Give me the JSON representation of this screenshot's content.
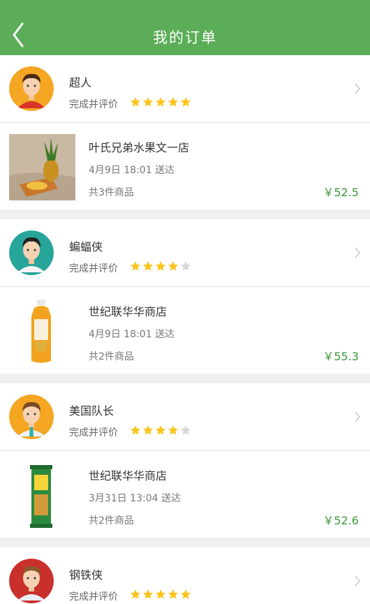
{
  "header": {
    "title": "我的订单"
  },
  "colors": {
    "accent": "#5cad58",
    "price": "#3a9a3a",
    "star_on": "#f9c51c",
    "star_off": "#d8d8d8"
  },
  "orders": [
    {
      "user": {
        "name": "超人",
        "status": "完成并评价",
        "rating": 5,
        "avatar_icon": "superman-avatar"
      },
      "store": {
        "name": "叶氏兄弟水果文一店",
        "delivery": "4月9日 18:01 送达",
        "count": "共3件商品",
        "price": "￥52.5",
        "image_icon": "pineapple-image"
      }
    },
    {
      "user": {
        "name": "蝙蝠侠",
        "status": "完成并评价",
        "rating": 4,
        "avatar_icon": "batman-avatar"
      },
      "store": {
        "name": "世纪联华华商店",
        "delivery": "4月9日 18:01 送达",
        "count": "共2件商品",
        "price": "￥55.3",
        "image_icon": "juice-bottle-image"
      }
    },
    {
      "user": {
        "name": "美国队长",
        "status": "完成并评价",
        "rating": 4,
        "avatar_icon": "captain-america-avatar"
      },
      "store": {
        "name": "世纪联华华商店",
        "delivery": "3月31日 13:04 送达",
        "count": "共2件商品",
        "price": "￥52.6",
        "image_icon": "snack-package-image"
      }
    },
    {
      "user": {
        "name": "钢铁侠",
        "status": "完成并评价",
        "rating": 5,
        "avatar_icon": "iron-man-avatar"
      }
    }
  ]
}
